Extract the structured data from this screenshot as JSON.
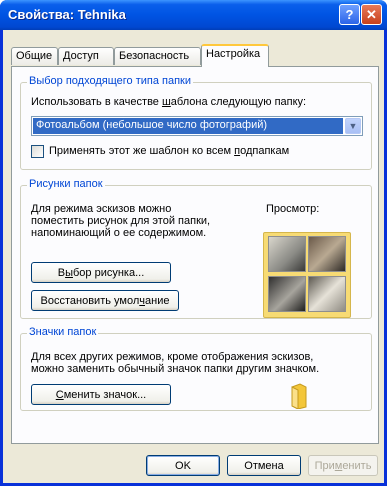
{
  "window": {
    "title": "Свойства: Tehnika",
    "help_glyph": "?",
    "close_glyph": "✕"
  },
  "tabs": [
    {
      "label": "Общие",
      "active": false
    },
    {
      "label": "Доступ",
      "active": false
    },
    {
      "label": "Безопасность",
      "active": false
    },
    {
      "label": "Настройка",
      "active": true
    }
  ],
  "template_group": {
    "legend": "Выбор подходящего типа папки",
    "prompt": {
      "before": "Использовать в качестве ",
      "hotkey": "ш",
      "after": "аблона следующую папку:"
    },
    "select_value": "Фотоальбом (небольшое число фотографий)",
    "checkbox_checked": false,
    "checkbox_label": {
      "before": "Применять этот же шаблон ко всем ",
      "hotkey": "п",
      "after": "одпапкам"
    }
  },
  "pictures_group": {
    "legend": "Рисунки папок",
    "description_lines": [
      "Для режима эскизов можно",
      "поместить рисунок для этой папки,",
      "напоминающий о ее содержимом."
    ],
    "preview_label": "Просмотр:",
    "choose_button": {
      "before": "В",
      "hotkey": "ы",
      "after": "бор рисунка..."
    },
    "restore_button": {
      "before": "Восстановить умол",
      "hotkey": "ч",
      "after": "ание"
    }
  },
  "icons_group": {
    "legend": "Значки папок",
    "description_lines": [
      "Для всех других режимов, кроме отображения эскизов,",
      "можно заменить обычный значок папки другим значком."
    ],
    "change_button": {
      "before": "",
      "hotkey": "С",
      "after": "менить значок..."
    }
  },
  "dialog_buttons": {
    "ok": "OK",
    "cancel": "Отмена",
    "apply": {
      "before": "При",
      "hotkey": "м",
      "after": "енить"
    },
    "apply_enabled": false
  },
  "colors": {
    "titlebar": "#0054E3",
    "selection": "#316AC5",
    "group_legend": "#0046D5",
    "folder": "#F7DB74"
  },
  "icons": {
    "folder": "folder-icon",
    "dropdown": "chevron-down-icon"
  }
}
